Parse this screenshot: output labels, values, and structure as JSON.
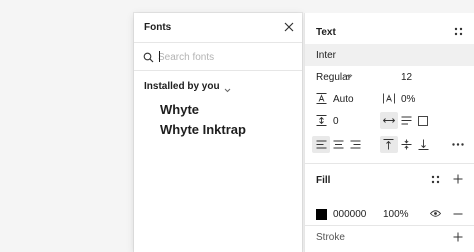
{
  "fonts_popover": {
    "title": "Fonts",
    "search": {
      "placeholder": "Search fonts",
      "value": ""
    },
    "group_label": "Installed by you",
    "fonts": [
      {
        "name": "Whyte"
      },
      {
        "name": "Whyte Inktrap"
      }
    ]
  },
  "design_panel": {
    "text_section": {
      "title": "Text",
      "font_family": "Inter",
      "font_weight": "Regular",
      "font_size": "12",
      "line_height": "Auto",
      "letter_spacing": "0%",
      "paragraph_spacing": "0"
    },
    "fill_section": {
      "title": "Fill",
      "color_hex": "000000",
      "color": "#000000",
      "opacity": "100%"
    },
    "stroke_section": {
      "title": "Stroke"
    }
  }
}
